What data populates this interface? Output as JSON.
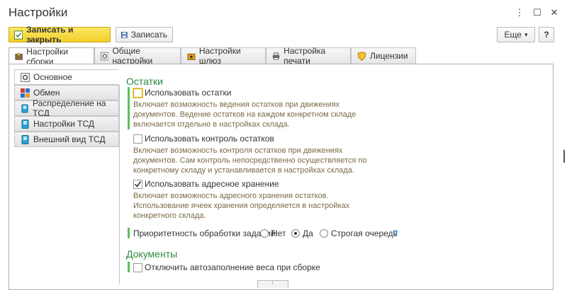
{
  "window": {
    "title": "Настройки",
    "menu_glyph": "⋮",
    "maximize_glyph": "☐",
    "close_glyph": "✕"
  },
  "toolbar": {
    "save_close_label": "Записать и закрыть",
    "save_label": "Записать",
    "more_label": "Еще",
    "more_arrow": "▾",
    "help_label": "?"
  },
  "tabs": [
    {
      "label": "Настройки сборки",
      "icon": "box-settings-icon",
      "active": true
    },
    {
      "label": "Общие настройки",
      "icon": "gear-icon",
      "active": false
    },
    {
      "label": "Настройки шлюз",
      "icon": "gateway-icon",
      "active": false
    },
    {
      "label": "Настройка печати",
      "icon": "printer-icon",
      "active": false
    },
    {
      "label": "Лицензии",
      "icon": "shield-icon",
      "active": false
    }
  ],
  "sidebar": {
    "items": [
      {
        "label": "Основное",
        "icon": "gear-icon",
        "active": true
      },
      {
        "label": "Обмен",
        "icon": "exchange-icon",
        "active": false
      },
      {
        "label": "Распределение на ТСД",
        "icon": "device-icon",
        "active": false
      },
      {
        "label": "Настройки ТСД",
        "icon": "device-icon",
        "active": false
      },
      {
        "label": "Внешний вид ТСД",
        "icon": "device-icon",
        "active": false
      }
    ]
  },
  "stock": {
    "title": "Остатки",
    "use_stock": {
      "label": "Использовать остатки",
      "checked": false,
      "desc": [
        "Включает возможность ведения остатков при движениях",
        "документов. Ведение остатков на каждом конкретном складе",
        "включается отдельно в настройках склада."
      ]
    },
    "use_control": {
      "label": "Использовать контроль остатков",
      "checked": false,
      "desc": [
        "Включает возможность контроля остатков при движениях",
        "документов. Сам контроль непосредственно осуществляется по",
        "конкретному складу и устанавливается в настройках склада."
      ]
    },
    "use_address": {
      "label": "Использовать адресное хранение",
      "checked": true,
      "desc": [
        "Включает возможность адресного хранения остатков.",
        "Использование ячеек хранения определяется в настройках",
        "конкретного склада."
      ]
    },
    "priority": {
      "label": "Приоритетность обработки заданий:",
      "options": [
        "Нет",
        "Да",
        "Строгая очередь"
      ],
      "selected": "Да",
      "help": "?"
    }
  },
  "documents": {
    "title": "Документы",
    "disable_weight": {
      "label": "Отключить автозаполнение веса при сборке",
      "checked": false
    }
  },
  "colors": {
    "accent": "#f2cf2c",
    "section": "#2b8a3e",
    "desc": "#7a6b45",
    "help": "#1f6fd1"
  }
}
